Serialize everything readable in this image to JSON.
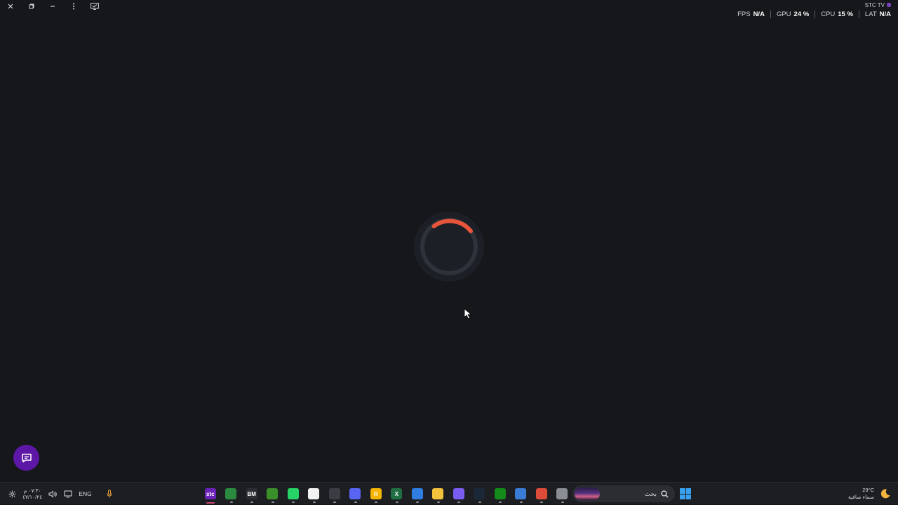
{
  "window_controls": [
    {
      "name": "close-icon",
      "label": "Close"
    },
    {
      "name": "restore-icon",
      "label": "Restore"
    },
    {
      "name": "minimize-icon",
      "label": "Minimize"
    },
    {
      "name": "more-vertical-icon",
      "label": "More options"
    },
    {
      "name": "screen-icon",
      "label": "Screen"
    }
  ],
  "stats": {
    "brand": "STC TV",
    "fps_label": "FPS",
    "fps_value": "N/A",
    "gpu_label": "GPU",
    "gpu_value": "24 %",
    "cpu_label": "CPU",
    "cpu_value": "15 %",
    "lat_label": "LAT",
    "lat_value": "N/A"
  },
  "spinner": {
    "accent_color": "#e8553a",
    "track_color": "#2e323a"
  },
  "chat": {
    "icon": "chat-icon",
    "color": "#5d17a6"
  },
  "taskbar": {
    "clock_time": "٠٧:٣٠ م",
    "clock_date": "٤٧/١٠/٢٤",
    "language": "ENG",
    "search_placeholder": "بحث",
    "weather_temp": "29°C",
    "weather_desc": "سماء صافية",
    "apps": [
      {
        "name": "stc-tv-app",
        "label": "stc",
        "color": "#6a22b8",
        "active": true
      },
      {
        "name": "chrome-profile-app",
        "label": "",
        "color": "#2a8a3e"
      },
      {
        "name": "bm-app",
        "label": "BM",
        "color": "#2b2d33"
      },
      {
        "name": "minecraft-app",
        "label": "",
        "color": "#3b8f2a"
      },
      {
        "name": "whatsapp-app",
        "label": "",
        "color": "#25d366"
      },
      {
        "name": "notepad-app",
        "label": "",
        "color": "#f2f2f2"
      },
      {
        "name": "clock-app",
        "label": "",
        "color": "#3a3d44"
      },
      {
        "name": "discord-app",
        "label": "",
        "color": "#5865f2"
      },
      {
        "name": "rockstar-app",
        "label": "R",
        "color": "#f5b400"
      },
      {
        "name": "excel-app",
        "label": "X",
        "color": "#1f6f43"
      },
      {
        "name": "store-app",
        "label": "",
        "color": "#2f7de0"
      },
      {
        "name": "explorer-app",
        "label": "",
        "color": "#f3c23c"
      },
      {
        "name": "copilot-app",
        "label": "",
        "color": "#7b5cf0"
      },
      {
        "name": "steam-app",
        "label": "",
        "color": "#1b2838"
      },
      {
        "name": "xbox-app",
        "label": "",
        "color": "#138a1a"
      },
      {
        "name": "roblox-app",
        "label": "",
        "color": "#3a7bd5"
      },
      {
        "name": "chrome-app",
        "label": "",
        "color": "#dd4b39"
      },
      {
        "name": "window-app",
        "label": "",
        "color": "#8a8d93"
      }
    ]
  }
}
